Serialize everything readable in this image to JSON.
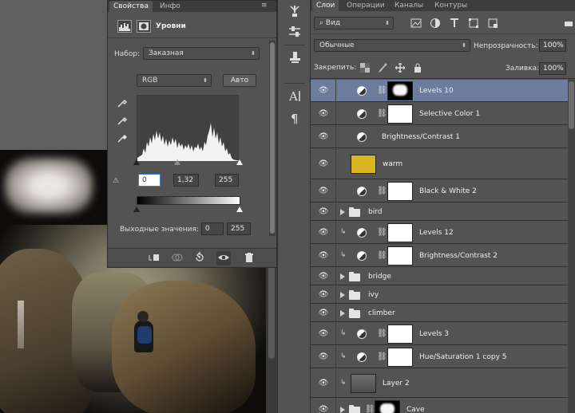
{
  "properties": {
    "tabs": [
      "Свойства",
      "Инфо"
    ],
    "menu_glyph": "≡",
    "title": "Уровни",
    "preset_label": "Набор:",
    "preset_value": "Заказная",
    "channel_value": "RGB",
    "auto_label": "Авто",
    "input_black": "0",
    "input_gamma": "1,32",
    "input_white": "255",
    "output_label": "Выходные значения:",
    "output_black": "0",
    "output_white": "255",
    "clip_warning_glyph": "⚠"
  },
  "layers_panel": {
    "tabs": [
      "Слои",
      "Операции",
      "Каналы",
      "Контуры"
    ],
    "filter_kind": "Вид",
    "blend_mode": "Обычные",
    "opacity_label": "Непрозрачность:",
    "opacity_value": "100%",
    "lock_label": "Закрепить:",
    "fill_label": "Заливка:",
    "fill_value": "100%",
    "layers": [
      {
        "name": "Levels 10",
        "kind": "adjustment",
        "thumb": "mask",
        "selected": true
      },
      {
        "name": "Selective Color 1",
        "kind": "adjustment",
        "thumb": "white"
      },
      {
        "name": "Brightness/Contrast 1",
        "kind": "adjustment-nomask"
      },
      {
        "name": "warm",
        "kind": "fill",
        "color": "#d9b51f"
      },
      {
        "name": "Black & White 2",
        "kind": "adjustment",
        "thumb": "white"
      },
      {
        "name": "bird",
        "kind": "group"
      },
      {
        "name": "Levels 12",
        "kind": "adjustment-clipped",
        "thumb": "white"
      },
      {
        "name": "Brightness/Contrast 2",
        "kind": "adjustment-clipped",
        "thumb": "white"
      },
      {
        "name": "bridge",
        "kind": "group"
      },
      {
        "name": "ivy",
        "kind": "group"
      },
      {
        "name": "climber",
        "kind": "group"
      },
      {
        "name": "Levels 3",
        "kind": "adjustment-clipped",
        "thumb": "white"
      },
      {
        "name": "Hue/Saturation 1 copy 5",
        "kind": "adjustment-clipped",
        "thumb": "white"
      },
      {
        "name": "Layer 2",
        "kind": "pixel"
      },
      {
        "name": "Cave",
        "kind": "group-masked"
      }
    ]
  },
  "colors": {
    "selected_row": "#6b7c9c",
    "panel_bg": "#535353",
    "warm_swatch": "#d9b51f"
  }
}
